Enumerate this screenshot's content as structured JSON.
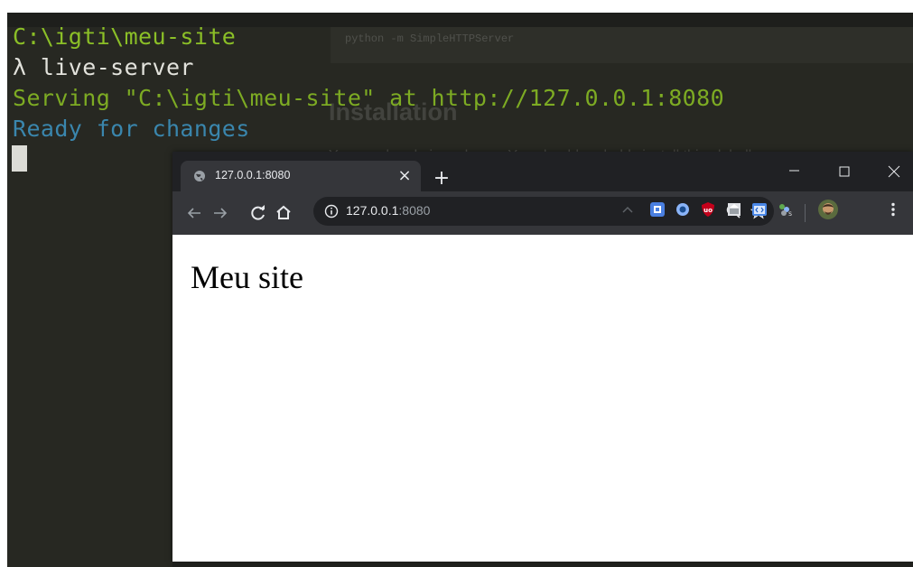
{
  "terminal": {
    "lines": [
      "C:\\igti\\meu-site",
      "λ live-server",
      "Serving \"C:\\igti\\meu-site\" at http://127.0.0.1:8080",
      "Ready for changes"
    ],
    "colors": {
      "path": "#8bbf27",
      "command": "#e2e2dc",
      "serving": "#7dab23",
      "ready": "#3a86ad"
    }
  },
  "background_page": {
    "code": "python -m SimpleHTTPServer",
    "heading": "Installation",
    "paragraph": "You need node.js and npm. You should probably install this globally."
  },
  "browser": {
    "tab_title": "127.0.0.1:8080",
    "url_host": "127.0.0.1",
    "url_port": ":8080",
    "extensions": [
      "calendar-icon",
      "circle-app-icon",
      "ublock-origin-icon",
      "document-icon",
      "code-tag-icon",
      "puzzle-icon"
    ],
    "toolbar_icons": [
      "back-arrow-icon",
      "forward-arrow-icon",
      "reload-icon",
      "home-icon",
      "zoom-icon",
      "bookmark-star-icon",
      "profile-avatar-icon",
      "menu-dots-icon"
    ]
  },
  "page": {
    "heading": "Meu site"
  }
}
